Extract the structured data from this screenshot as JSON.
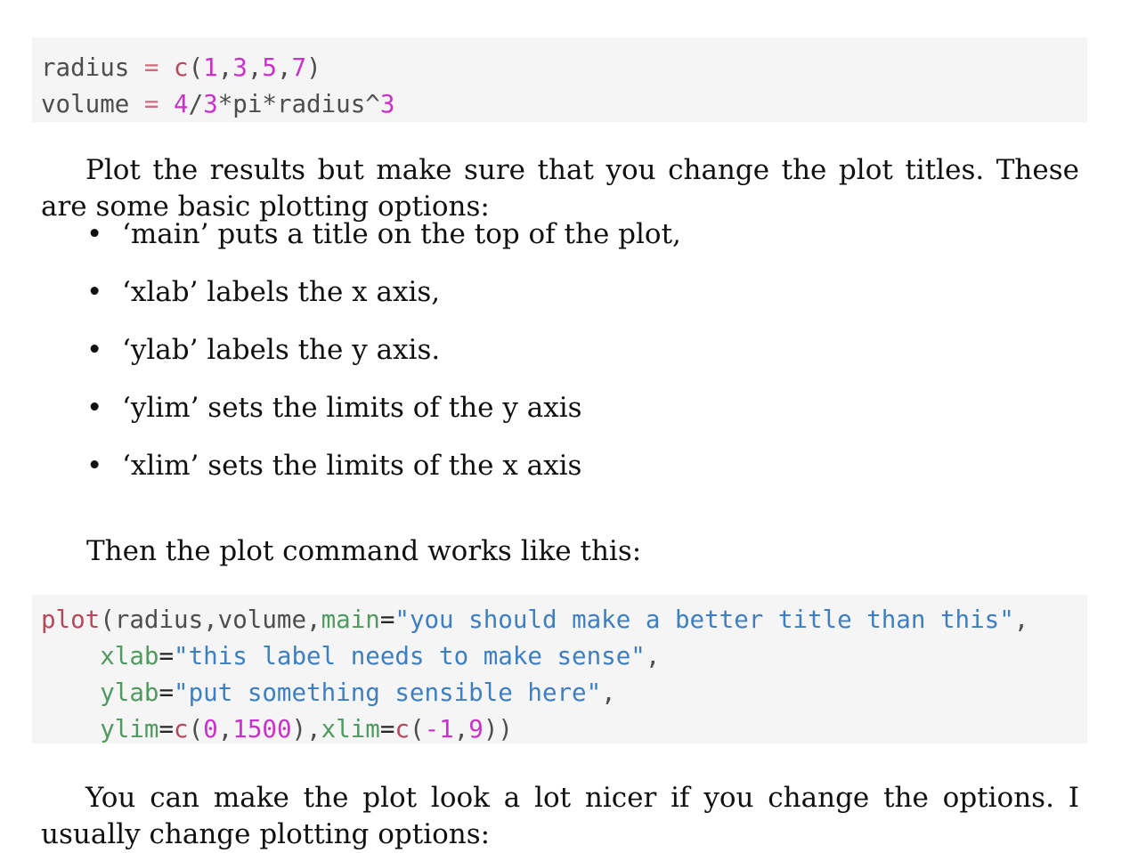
{
  "document": {
    "code_block_1": {
      "lines": [
        {
          "tokens": [
            {
              "text": "radius ",
              "kind": "plain"
            },
            {
              "text": "=",
              "kind": "op"
            },
            {
              "text": " ",
              "kind": "plain"
            },
            {
              "text": "c",
              "kind": "fn"
            },
            {
              "text": "(",
              "kind": "punct"
            },
            {
              "text": "1",
              "kind": "num"
            },
            {
              "text": ",",
              "kind": "punct"
            },
            {
              "text": "3",
              "kind": "num"
            },
            {
              "text": ",",
              "kind": "punct"
            },
            {
              "text": "5",
              "kind": "num"
            },
            {
              "text": ",",
              "kind": "punct"
            },
            {
              "text": "7",
              "kind": "num"
            },
            {
              "text": ")",
              "kind": "punct"
            }
          ]
        },
        {
          "tokens": [
            {
              "text": "volume ",
              "kind": "plain"
            },
            {
              "text": "=",
              "kind": "op"
            },
            {
              "text": " ",
              "kind": "plain"
            },
            {
              "text": "4",
              "kind": "num"
            },
            {
              "text": "/",
              "kind": "punct"
            },
            {
              "text": "3",
              "kind": "num"
            },
            {
              "text": "*pi*radius^",
              "kind": "punct"
            },
            {
              "text": "3",
              "kind": "num"
            }
          ]
        }
      ],
      "plain_text": "radius = c(1,3,5,7)\nvolume = 4/3*pi*radius^3"
    },
    "paragraph_1": "Plot the results but make sure that you change the plot titles. These are some basic plotting options:",
    "options_list": [
      "‘main’ puts a title on the top of the plot,",
      "‘xlab’ labels the x axis,",
      "‘ylab’ labels the y axis.",
      "‘ylim’ sets the limits of the y axis",
      "‘xlim’ sets the limits of the x axis"
    ],
    "bullet_glyph": "•",
    "paragraph_2": "Then the plot command works like this:",
    "code_block_2": {
      "lines": [
        {
          "tokens": [
            {
              "text": "plot",
              "kind": "fn"
            },
            {
              "text": "(radius,volume,",
              "kind": "punct"
            },
            {
              "text": "main",
              "kind": "arg"
            },
            {
              "text": "=",
              "kind": "eq"
            },
            {
              "text": "\"you should make a better title than this\"",
              "kind": "str"
            },
            {
              "text": ",",
              "kind": "punct"
            }
          ]
        },
        {
          "tokens": [
            {
              "text": "    ",
              "kind": "plain"
            },
            {
              "text": "xlab",
              "kind": "arg"
            },
            {
              "text": "=",
              "kind": "eq"
            },
            {
              "text": "\"this label needs to make sense\"",
              "kind": "str"
            },
            {
              "text": ",",
              "kind": "punct"
            }
          ]
        },
        {
          "tokens": [
            {
              "text": "    ",
              "kind": "plain"
            },
            {
              "text": "ylab",
              "kind": "arg"
            },
            {
              "text": "=",
              "kind": "eq"
            },
            {
              "text": "\"put something sensible here\"",
              "kind": "str"
            },
            {
              "text": ",",
              "kind": "punct"
            }
          ]
        },
        {
          "tokens": [
            {
              "text": "    ",
              "kind": "plain"
            },
            {
              "text": "ylim",
              "kind": "arg"
            },
            {
              "text": "=",
              "kind": "eq"
            },
            {
              "text": "c",
              "kind": "fn"
            },
            {
              "text": "(",
              "kind": "punct"
            },
            {
              "text": "0",
              "kind": "num"
            },
            {
              "text": ",",
              "kind": "punct"
            },
            {
              "text": "1500",
              "kind": "num"
            },
            {
              "text": "),",
              "kind": "punct"
            },
            {
              "text": "xlim",
              "kind": "arg"
            },
            {
              "text": "=",
              "kind": "eq"
            },
            {
              "text": "c",
              "kind": "fn"
            },
            {
              "text": "(",
              "kind": "punct"
            },
            {
              "text": "-1",
              "kind": "num"
            },
            {
              "text": ",",
              "kind": "punct"
            },
            {
              "text": "9",
              "kind": "num"
            },
            {
              "text": "))",
              "kind": "punct"
            }
          ]
        }
      ],
      "plain_text": "plot(radius,volume,main=\"you should make a better title than this\",\n    xlab=\"this label needs to make sense\",\n    ylab=\"put something sensible here\",\n    ylim=c(0,1500),xlim=c(-1,9))"
    },
    "paragraph_3": "You can make the plot look a lot nicer if you change the options. I usually change plotting options:"
  },
  "colors": {
    "code_background": "#f5f5f5",
    "identifier": "#4d4d4d",
    "assign_operator": "#d16b7e",
    "equals_operator": "#262626",
    "number": "#c832c8",
    "function": "#b5495b",
    "argument": "#4f9a5e",
    "string": "#3e7fc1",
    "body_text": "#101010"
  }
}
